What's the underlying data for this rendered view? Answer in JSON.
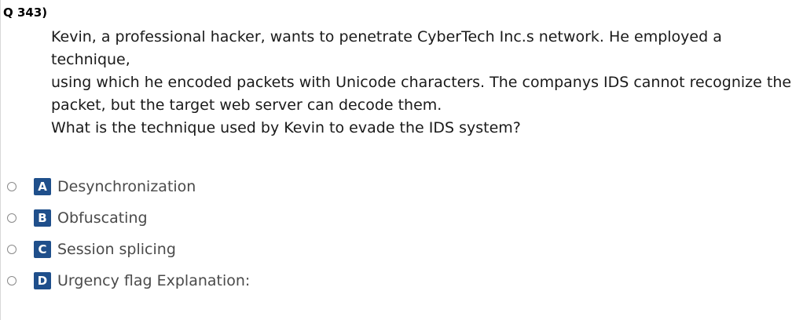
{
  "question": {
    "number": "Q 343)",
    "lines": [
      "Kevin, a professional hacker, wants to penetrate CyberTech Inc.s network. He employed a technique,",
      "using which he encoded packets with Unicode characters. The companys IDS cannot recognize the",
      "packet, but the target web server can decode them.",
      "What is the technique used by Kevin to evade the IDS system?"
    ]
  },
  "options": [
    {
      "letter": "A",
      "text": "Desynchronization"
    },
    {
      "letter": "B",
      "text": "Obfuscating"
    },
    {
      "letter": "C",
      "text": "Session splicing"
    },
    {
      "letter": "D",
      "text": "Urgency flag Explanation:"
    }
  ],
  "colors": {
    "badge": "#1f4f8b",
    "option_text": "#4a4a4a",
    "question_text": "#1a1a1a"
  }
}
